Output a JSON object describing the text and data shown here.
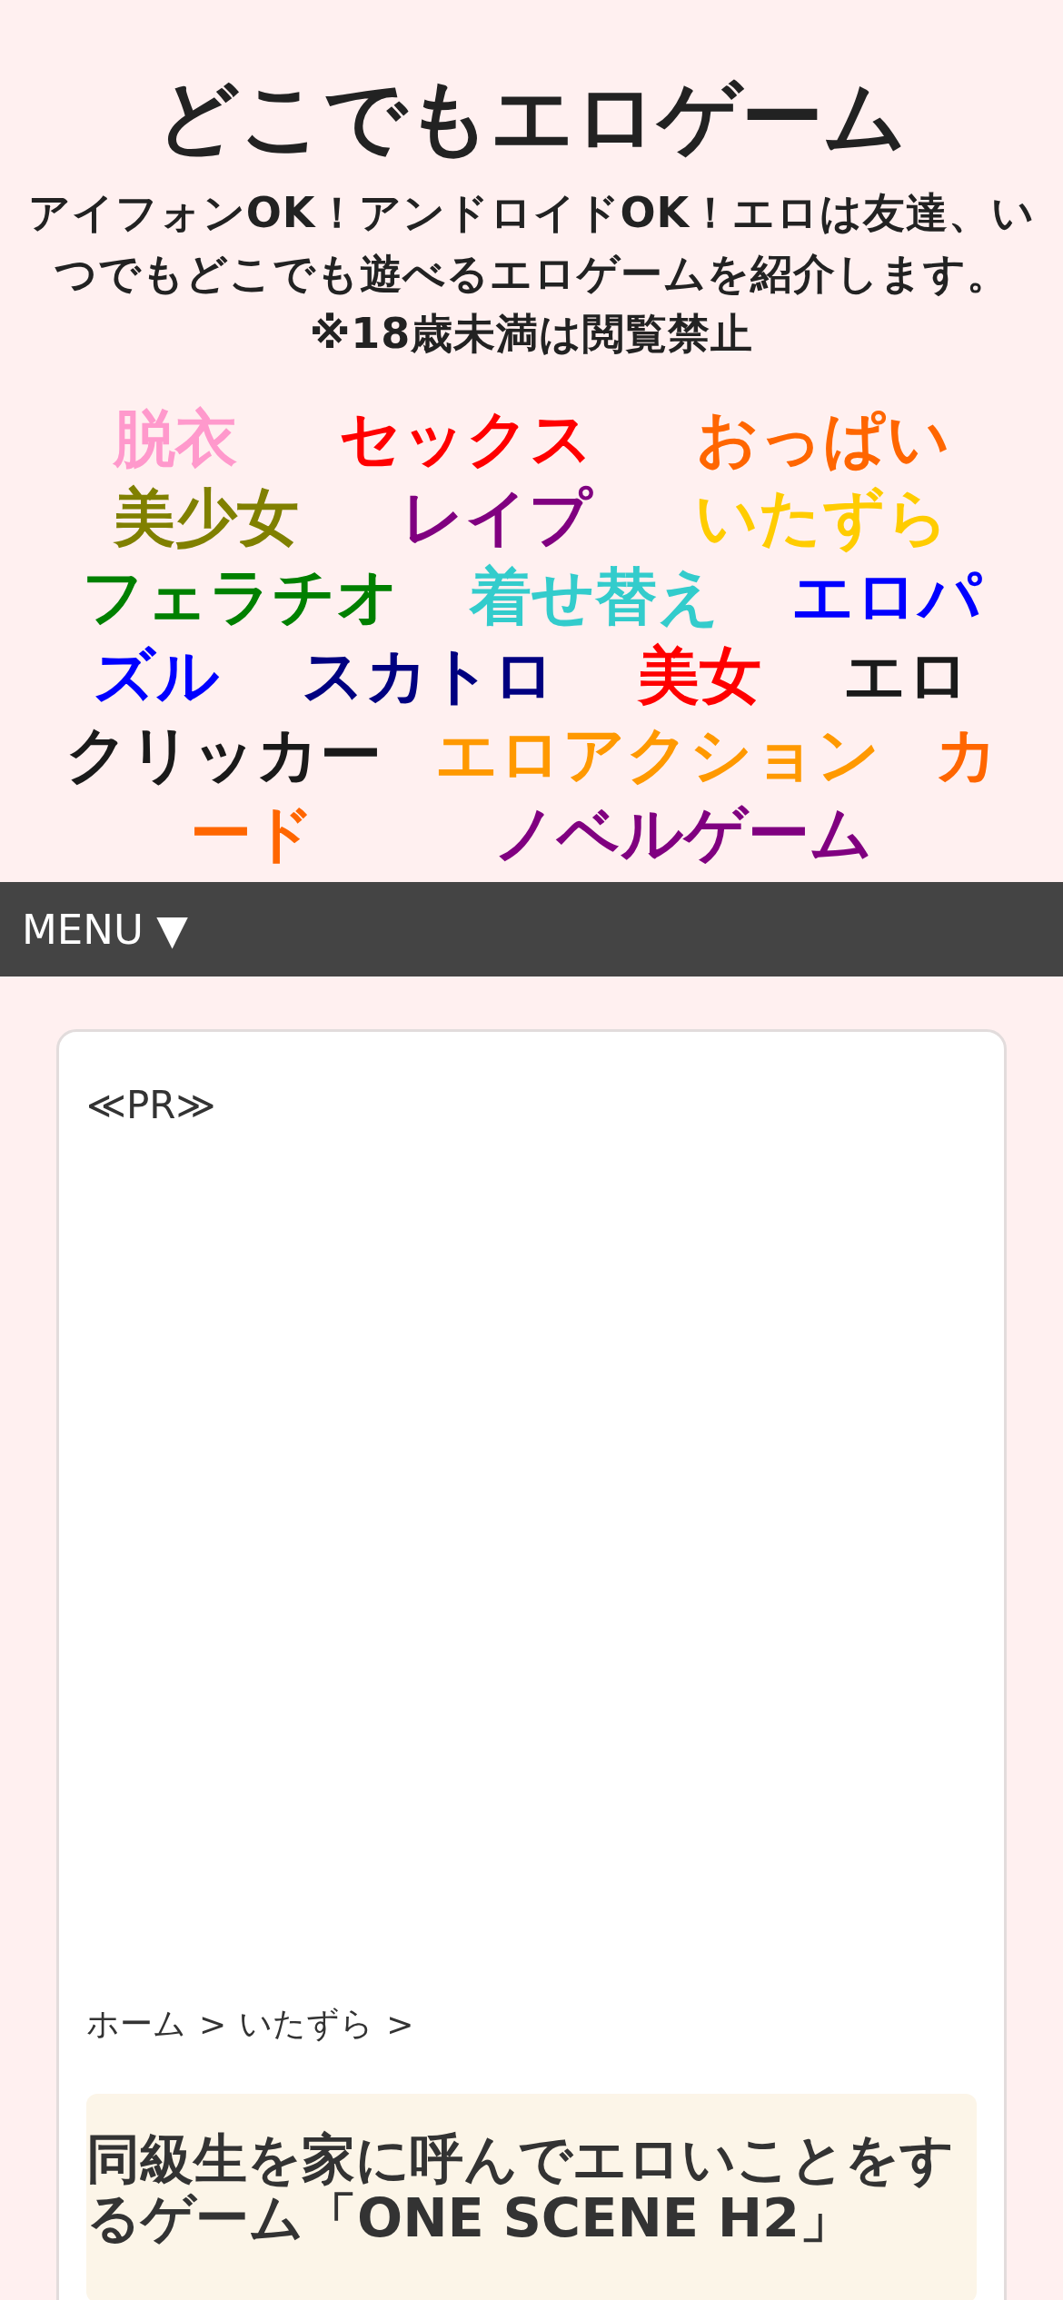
{
  "site": {
    "title": "どこでもエロゲーム",
    "tagline": "アイフォンOK！アンドロイドOK！エロは友達、いつでもどこでも遊べるエロゲームを紹介します。※18歳未満は閲覧禁止"
  },
  "tag_rows": [
    [
      {
        "label": "脱衣",
        "color": "#ff99cc"
      },
      {
        "label": "セックス",
        "color": "#ff0000"
      },
      {
        "label": "おっぱい",
        "color": "#ff6600"
      }
    ],
    [
      {
        "label": "美少女",
        "color": "#808000"
      },
      {
        "label": "レイプ",
        "color": "#800080"
      },
      {
        "label": "いたずら",
        "color": "#ffcc00"
      }
    ],
    [
      {
        "label": "フェラチオ",
        "color": "#008000"
      },
      {
        "label": "着せ替え",
        "color": "#33cccc"
      },
      {
        "label": "エロパ",
        "color": "#0000ff"
      }
    ],
    [
      {
        "label": "ズル",
        "color": "#0000ff"
      },
      {
        "label": "スカトロ",
        "color": "#000080"
      },
      {
        "label": "美女",
        "color": "#ff0000"
      },
      {
        "label": "エロ",
        "color": "#1a1a1a"
      }
    ],
    [
      {
        "label": "クリッカー",
        "color": "#1a1a1a"
      },
      {
        "label": "エロアクション",
        "color": "#ff9900"
      },
      {
        "label": "カ",
        "color": "#ff6600"
      }
    ],
    [
      {
        "label": "ード",
        "color": "#ff6600"
      },
      {
        "label": "ノベルゲーム",
        "color": "#800080"
      }
    ]
  ],
  "menu": {
    "label": "MENU ▼"
  },
  "article": {
    "pr_label": "≪PR≫",
    "breadcrumb": [
      "ホーム",
      "いたずら"
    ],
    "breadcrumb_separator": ">",
    "title": "同級生を家に呼んでエロいことをするゲーム「ONE SCENE H2」"
  }
}
